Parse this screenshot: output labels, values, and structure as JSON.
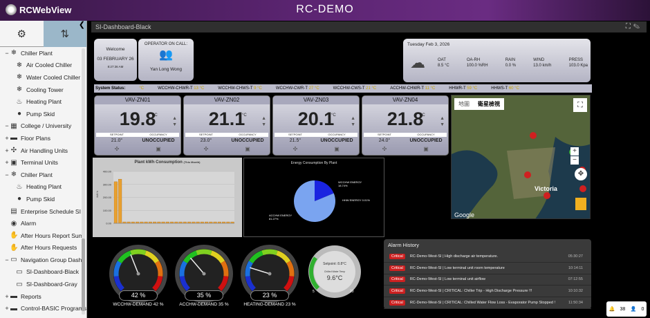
{
  "app": {
    "logo": "RCWebView",
    "title": "RC-DEMO"
  },
  "sidebar": {
    "items": [
      {
        "label": "Chiller Plant",
        "icon": "snowflake-icon",
        "glyph": "❄",
        "toggle": "−"
      },
      {
        "label": "Air Cooled Chiller",
        "icon": "snowflake-icon",
        "glyph": "❄",
        "toggle": ""
      },
      {
        "label": "Water Cooled Chiller",
        "icon": "snowflake-icon",
        "glyph": "❄",
        "toggle": ""
      },
      {
        "label": "Cooling Tower",
        "icon": "snowflake-icon",
        "glyph": "❄",
        "toggle": ""
      },
      {
        "label": "Heating Plant",
        "icon": "flame-icon",
        "glyph": "♨",
        "toggle": ""
      },
      {
        "label": "Pump Skid",
        "icon": "drop-icon",
        "glyph": "●",
        "toggle": ""
      },
      {
        "label": "College / University",
        "icon": "building-icon",
        "glyph": "▦",
        "toggle": "−"
      },
      {
        "label": "Floor Plans",
        "icon": "folder-icon",
        "glyph": "▬",
        "toggle": "+"
      },
      {
        "label": "Air Handling Units",
        "icon": "fan-icon",
        "glyph": "✣",
        "toggle": "+"
      },
      {
        "label": "Terminal Units",
        "icon": "terminal-icon",
        "glyph": "▣",
        "toggle": "+"
      },
      {
        "label": "Chiller Plant",
        "icon": "snowflake-icon",
        "glyph": "❄",
        "toggle": "−"
      },
      {
        "label": "Heating Plant",
        "icon": "flame-icon",
        "glyph": "♨",
        "toggle": ""
      },
      {
        "label": "Pump Skid",
        "icon": "drop-icon",
        "glyph": "●",
        "toggle": ""
      },
      {
        "label": "Enterprise Schedule SI",
        "icon": "schedule-icon",
        "glyph": "▤",
        "toggle": ""
      },
      {
        "label": "Alarm",
        "icon": "alarm-icon",
        "glyph": "◉",
        "toggle": ""
      },
      {
        "label": "After Hours Report Sum",
        "icon": "report-icon",
        "glyph": "✋",
        "toggle": ""
      },
      {
        "label": "After Hours Requests",
        "icon": "request-icon",
        "glyph": "✋",
        "toggle": ""
      },
      {
        "label": "Navigation Group Dashb",
        "icon": "dashboard-icon",
        "glyph": "▭",
        "toggle": "−"
      },
      {
        "label": "SI-Dashboard-Black",
        "icon": "dashboard-icon",
        "glyph": "▭",
        "toggle": ""
      },
      {
        "label": "SI-Dashboard-Gray",
        "icon": "dashboard-icon",
        "glyph": "▭",
        "toggle": ""
      },
      {
        "label": "Reports",
        "icon": "folder-icon",
        "glyph": "▬",
        "toggle": "+"
      },
      {
        "label": "Control-BASIC Programs",
        "icon": "program-icon",
        "glyph": "▬",
        "toggle": "+"
      }
    ]
  },
  "breadcrumb": "SI-Dashboard-Black",
  "welcome": {
    "title": "Welcome",
    "date": "03 FEBRUARY 26",
    "time": "8:27:36 AM"
  },
  "operator": {
    "title": "OPERATOR ON CALL:",
    "name": "Yan Long Wong"
  },
  "weather": {
    "date": "Tuesday Feb 3, 2026",
    "items": [
      {
        "label": "OAT",
        "value": "8.5 °C"
      },
      {
        "label": "OA-RH",
        "value": "100.0 %RH"
      },
      {
        "label": "RAIN",
        "value": "0.0 %"
      },
      {
        "label": "WIND",
        "value": "13.0 km/h"
      },
      {
        "label": "PRESS",
        "value": "103.0 Kpa"
      }
    ]
  },
  "status": {
    "label": "System Status:",
    "first_unit": "°C",
    "items": [
      {
        "name": "WCCHW-CHWR-T",
        "value": "13 °C"
      },
      {
        "name": "WCCHW-CHWS-T",
        "value": "9 °C"
      },
      {
        "name": "WCCHW-CWR-T",
        "value": "27 °C"
      },
      {
        "name": "WCCHW-CWS-T",
        "value": "21 °C"
      },
      {
        "name": "ACCHW-CHWR-T",
        "value": "11 °C"
      },
      {
        "name": "HHWR-T",
        "value": "59 °C"
      },
      {
        "name": "HHWS-T",
        "value": "60 °C"
      }
    ]
  },
  "vavs": [
    {
      "name": "VAV-ZN01",
      "temp": "19.8",
      "unit": "°C",
      "setpoint_label": "SETPOINT",
      "occupancy_label": "OCCUPANCY",
      "setpoint": "21.0°",
      "occupancy": "UNOCCUPIED"
    },
    {
      "name": "VAV-ZN02",
      "temp": "21.1",
      "unit": "°C",
      "setpoint_label": "SETPOINT",
      "occupancy_label": "OCCUPANCY",
      "setpoint": "23.0°",
      "occupancy": "UNOCCUPIED"
    },
    {
      "name": "VAV-ZN03",
      "temp": "20.1",
      "unit": "°C",
      "setpoint_label": "SETPOINT",
      "occupancy_label": "OCCUPANCY",
      "setpoint": "21.5°",
      "occupancy": "UNOCCUPIED"
    },
    {
      "name": "VAV-ZN04",
      "temp": "21.8",
      "unit": "°C",
      "setpoint_label": "SETPOINT",
      "occupancy_label": "OCCUPANCY",
      "setpoint": "24.0°",
      "occupancy": "UNOCCUPIED"
    }
  ],
  "map": {
    "tab_map": "地圖",
    "tab_sat": "衛星檢視",
    "city": "Victoria",
    "google": "Google"
  },
  "chart_data": [
    {
      "type": "bar",
      "title": "Plant kWh Consumption",
      "subtitle": "(This Month)",
      "ylabel": "kW·h",
      "ylim": [
        0,
        400
      ],
      "yticks": [
        "400.00",
        "300.00",
        "200.00",
        "100.00",
        "0.00"
      ],
      "values": [
        310,
        330,
        0,
        0,
        0,
        0,
        0,
        0,
        0,
        0,
        0,
        0,
        0,
        0,
        0,
        0,
        0,
        0,
        0,
        0,
        0,
        0,
        0,
        0,
        0,
        0,
        0,
        0
      ],
      "bar_color": "#e8a030"
    },
    {
      "type": "pie",
      "title": "Energy Consumption By Plant",
      "slices": [
        {
          "name": "WCCHW ENERGY",
          "value": 18.74,
          "label": "18.74%",
          "color": "#1a24e0"
        },
        {
          "name": "HHW ENERGY",
          "value": 0.01,
          "label": "0.01%",
          "color": "#0a0aa0"
        },
        {
          "name": "ACCHW ENERGY",
          "value": 81.27,
          "label": "81.27%",
          "color": "#7aa4f0"
        }
      ]
    }
  ],
  "gauges": [
    {
      "label": "WCCHW-DEMAND 42 %",
      "value": "42 %",
      "pct": 42
    },
    {
      "label": "ACCHW-DEMAND 35 %",
      "value": "35 %",
      "pct": 35
    },
    {
      "label": "HEATING-DEMAND 23 %",
      "value": "23 %",
      "pct": 23
    }
  ],
  "temp_gauge": {
    "setpoint": "Setpoint: 8.8°C",
    "label": "Chilled Water Temp",
    "value": "9.6°C",
    "min": "5",
    "max": "20",
    "level": 0.3
  },
  "alarm": {
    "title": "Alarm History",
    "rows": [
      {
        "severity": "Critical",
        "msg": "RC-Demo-West-SI  |  High discharge air temperature.",
        "time": "05:30:27"
      },
      {
        "severity": "Critical",
        "msg": "RC-Demo-West-SI  |  Low terminal unit room temperature",
        "time": "10:14:11"
      },
      {
        "severity": "Critical",
        "msg": "RC-Demo-West-SI  |  Low terminal unit airflow",
        "time": "07:12:55"
      },
      {
        "severity": "Critical",
        "msg": "RC-Demo-West-SI  |  CRITICAL: Chiller Trip - High Discharge Pressure !!!",
        "time": "10:10:32"
      },
      {
        "severity": "Critical",
        "msg": "RC-Demo-West-SI  |  CRITICAL: Chilled Water Flow Loss - Evaporator Pump Stopped !!!",
        "time": "11:50:34"
      }
    ]
  },
  "corner": {
    "alarms": "38",
    "users": "0"
  }
}
